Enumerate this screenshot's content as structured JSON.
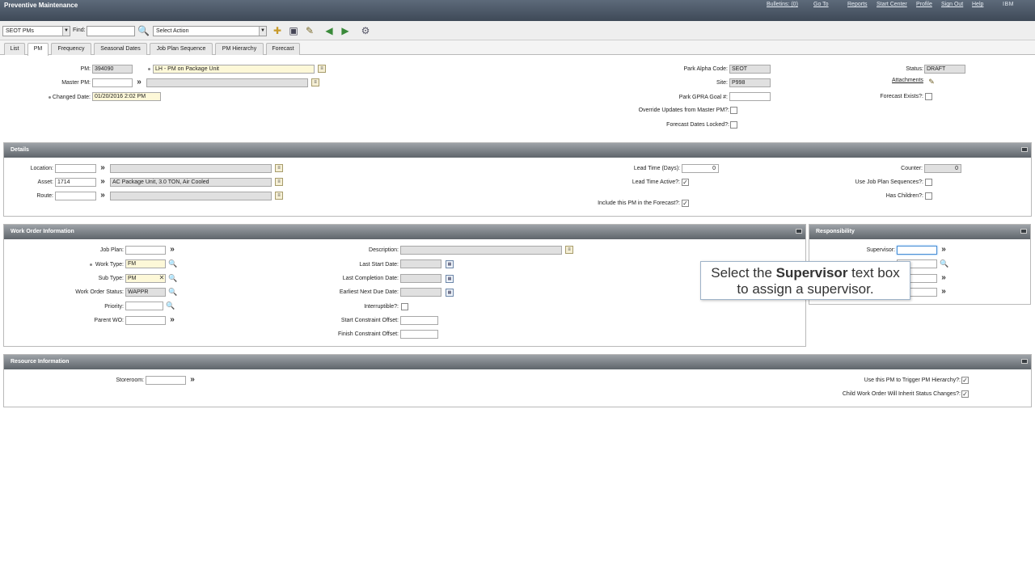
{
  "header": {
    "title": "Preventive Maintenance",
    "menu": [
      "Bulletins: (0)",
      "Go To",
      "Reports",
      "Start Center",
      "Profile",
      "Sign Out",
      "Help"
    ],
    "logo": "IBM"
  },
  "toolbar": {
    "query_select": "SEOT PMs",
    "find_label": "Find:",
    "find_value": "",
    "action_select": "Select Action"
  },
  "tabs": [
    "List",
    "PM",
    "Frequency",
    "Seasonal Dates",
    "Job Plan Sequence",
    "PM Hierarchy",
    "Forecast"
  ],
  "active_tab": "PM",
  "pm": {
    "pm_label": "PM:",
    "pm_value": "394090",
    "pm_desc": "LH - PM on Package Unit",
    "master_pm_label": "Master PM:",
    "master_pm_value": "",
    "changed_date_label": "Changed Date:",
    "changed_date_value": "01/20/2016 2:02 PM",
    "park_alpha_label": "Park Alpha Code:",
    "park_alpha_value": "SEOT",
    "site_label": "Site:",
    "site_value": "P998",
    "gpra_label": "Park GPRA Goal #:",
    "gpra_value": "",
    "override_label": "Override Updates from Master PM?:",
    "forecast_locked_label": "Forecast Dates Locked?:",
    "status_label": "Status:",
    "status_value": "DRAFT",
    "attachments_label": "Attachments",
    "forecast_exists_label": "Forecast Exists?:"
  },
  "details": {
    "title": "Details",
    "location_label": "Location:",
    "location_value": "",
    "asset_label": "Asset:",
    "asset_value": "1714",
    "asset_desc": "AC Package Unit, 3.0 TON, Air Cooled",
    "route_label": "Route:",
    "route_value": "",
    "lead_time_label": "Lead Time (Days):",
    "lead_time_value": "0",
    "lead_active_label": "Lead Time Active?:",
    "include_label": "Include this PM in the Forecast?:",
    "counter_label": "Counter:",
    "counter_value": "0",
    "use_jps_label": "Use Job Plan Sequences?:",
    "has_children_label": "Has Children?:"
  },
  "work_order": {
    "title": "Work Order Information",
    "job_plan_label": "Job Plan:",
    "job_plan_value": "",
    "work_type_label": "Work Type:",
    "work_type_value": "FM",
    "sub_type_label": "Sub Type:",
    "sub_type_value": "PM",
    "wo_status_label": "Work Order Status:",
    "wo_status_value": "WAPPR",
    "priority_label": "Priority:",
    "priority_value": "",
    "parent_wo_label": "Parent WO:",
    "parent_wo_value": "",
    "description_label": "Description:",
    "last_start_label": "Last Start Date:",
    "last_completion_label": "Last Completion Date:",
    "earliest_next_label": "Earliest Next Due Date:",
    "interruptible_label": "Interruptible?:",
    "start_offset_label": "Start Constraint Offset:",
    "finish_offset_label": "Finish Constraint Offset:"
  },
  "responsibility": {
    "title": "Responsibility",
    "supervisor_label": "Supervisor:"
  },
  "resource": {
    "title": "Resource Information",
    "storeroom_label": "Storeroom:",
    "storeroom_value": "",
    "trigger_label": "Use this PM to Trigger PM Hierarchy?:",
    "inherit_label": "Child Work Order Will Inherit Status Changes?:"
  },
  "callout": {
    "line1_pre": "Select the ",
    "line1_bold": "Supervisor",
    "line1_post": " text box",
    "line2": "to assign a supervisor."
  }
}
